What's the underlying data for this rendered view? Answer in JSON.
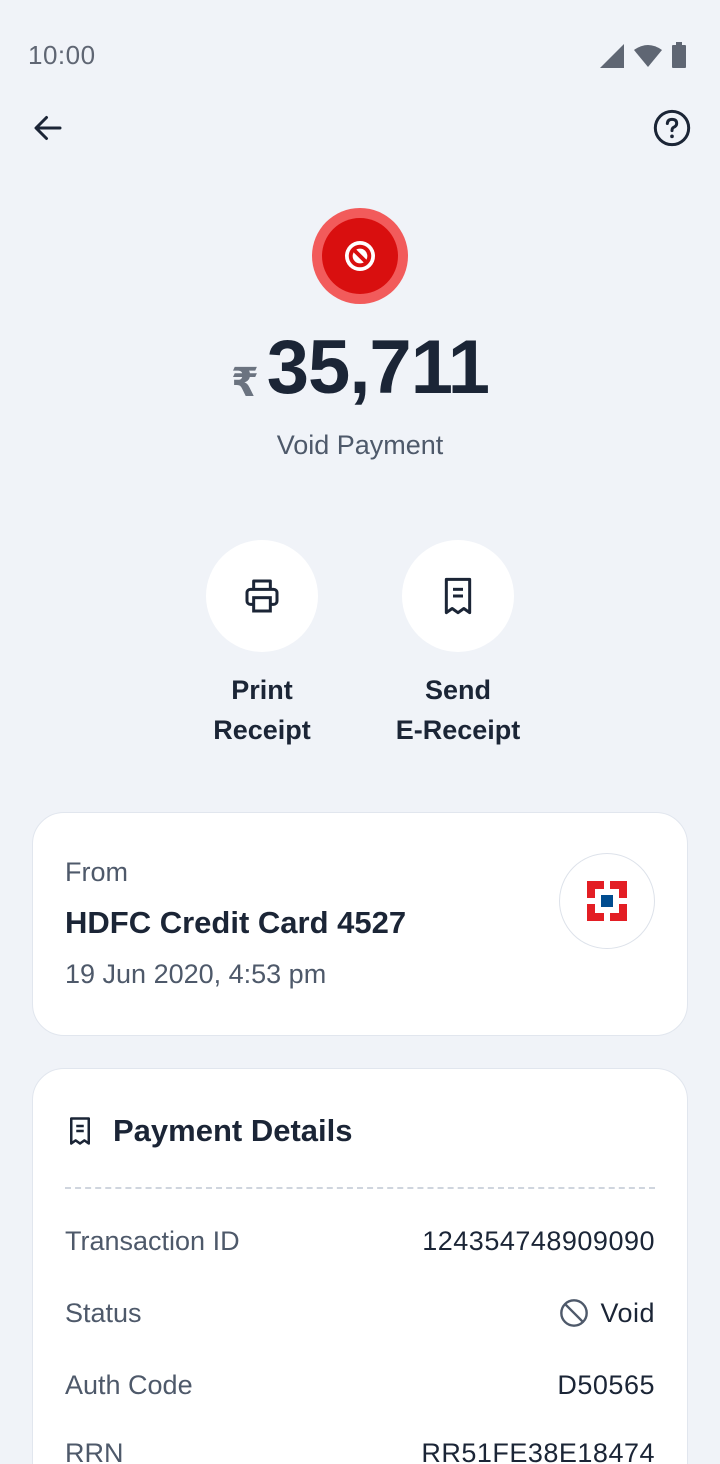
{
  "status_bar": {
    "time": "10:00"
  },
  "header": {
    "back_icon": "arrow-left-icon",
    "help_icon": "help-circle-icon"
  },
  "hero": {
    "status_icon": "void-block-icon",
    "currency_symbol": "₹",
    "amount": "35,711",
    "label": "Void Payment"
  },
  "actions": [
    {
      "label": "Print\nReceipt",
      "icon": "printer-icon"
    },
    {
      "label": "Send\nE-Receipt",
      "icon": "receipt-icon"
    }
  ],
  "from_card": {
    "label": "From",
    "source": "HDFC Credit Card 4527",
    "datetime": "19 Jun 2020, 4:53 pm",
    "logo": "hdfc-bank-logo"
  },
  "payment_details": {
    "title": "Payment Details",
    "rows": [
      {
        "key": "Transaction ID",
        "value": "124354748909090"
      },
      {
        "key": "Status",
        "value": "Void",
        "icon": "block-icon"
      },
      {
        "key": "Auth Code",
        "value": "D50565"
      },
      {
        "key": "RRN",
        "value": "RR51FE38E18474"
      }
    ]
  },
  "colors": {
    "background": "#f0f3f8",
    "void_red": "#d90f0f",
    "void_ring": "#f25b5b",
    "text_primary": "#1b2536",
    "text_secondary": "#4e596a"
  }
}
